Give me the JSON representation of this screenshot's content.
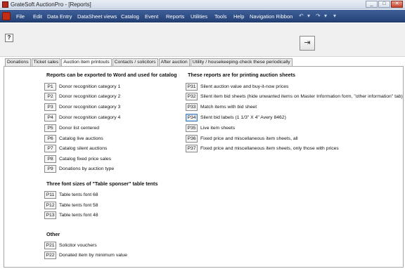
{
  "window": {
    "title": "GrateSoft AuctionPro - [Reports]",
    "minimize": "_",
    "maximize": "□",
    "close": "✕"
  },
  "menu": [
    "File",
    "Edit",
    "Data Entry",
    "DataSheet views",
    "Catalog",
    "Event",
    "Reports",
    "Utilities",
    "Tools",
    "Help",
    "Navigation Ribbon"
  ],
  "quick_access": {
    "undo": "↶",
    "redo": "↷",
    "more": "▾"
  },
  "toolbar": {
    "help_button": "?",
    "exit_glyph": "⇥"
  },
  "tabs": [
    {
      "label": "Donations",
      "active": false
    },
    {
      "label": "Ticket sales",
      "active": false
    },
    {
      "label": "Auction item printouts",
      "active": true
    },
    {
      "label": "Contacts / solicitors",
      "active": false
    },
    {
      "label": "After auction",
      "active": false
    },
    {
      "label": "Utility / housekeeping-check these periodically",
      "active": false
    }
  ],
  "left": {
    "catalog_header": "Reports can be exported to Word and used for catalog",
    "catalog_reports": [
      {
        "code": "P1",
        "label": "Donor recognition category 1"
      },
      {
        "code": "P2",
        "label": "Donor recognition category 2"
      },
      {
        "code": "P3",
        "label": "Donor recognition category 3"
      },
      {
        "code": "P4",
        "label": "Donor recognition category 4"
      },
      {
        "code": "P5",
        "label": "Donor list centered"
      },
      {
        "code": "P6",
        "label": "Catalog live auctions"
      },
      {
        "code": "P7",
        "label": "Catalog silent auctions"
      },
      {
        "code": "P8",
        "label": "Catalog fixed price sales"
      },
      {
        "code": "P9",
        "label": "Donations by auction type"
      }
    ],
    "tent_header": "Three font sizes of \"Table sponser\" table tents",
    "tent_reports": [
      {
        "code": "P11",
        "label": "Table tents font 68"
      },
      {
        "code": "P12",
        "label": "Table tents font 58"
      },
      {
        "code": "P13",
        "label": "Table tents font 48"
      }
    ],
    "other_header": "Other",
    "other_reports": [
      {
        "code": "P21",
        "label": "Solicitor vouchers"
      },
      {
        "code": "P22",
        "label": "Donated item by minimum value"
      }
    ]
  },
  "right": {
    "header": "These reports are for printing auction sheets",
    "reports": [
      {
        "code": "P31",
        "label": "Silent auction value and buy-it-now prices"
      },
      {
        "code": "P32",
        "label": "Silent item bid sheets (hide unwanted items on Master Information form, \"other information\" tab)"
      },
      {
        "code": "P33",
        "label": "Match items with bid sheet"
      },
      {
        "code": "P34",
        "label": "Silent bid labels (1 1/3\" X 4\" Avery 8462)",
        "focused": true
      },
      {
        "code": "P35",
        "label": "Live item sheets"
      },
      {
        "code": "P36",
        "label": "Fixed price and miscellaneous item sheets, all"
      },
      {
        "code": "P37",
        "label": "Fixed price and miscellaneous item sheets, only those with prices"
      }
    ]
  }
}
